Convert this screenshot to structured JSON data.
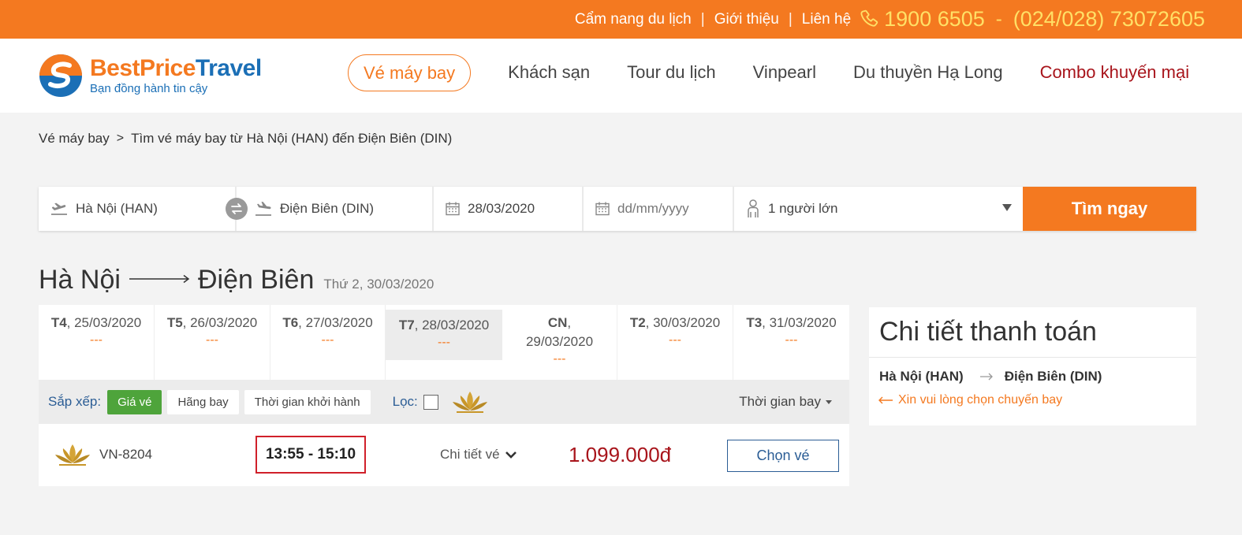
{
  "topbar": {
    "links": [
      "Cẩm nang du lịch",
      "Giới thiệu",
      "Liên hệ"
    ],
    "separator": "|",
    "phone_main": "1900 6505",
    "phone_dash": "-",
    "phone_alt": "(024/028) 73072605",
    "bg_color": "#f47920",
    "phone_color": "#ffe066"
  },
  "logo": {
    "name_part1": "BestPrice",
    "name_part2": "Travel",
    "tagline": "Bạn đồng hành tin cậy"
  },
  "nav": {
    "items": [
      "Vé máy bay",
      "Khách sạn",
      "Tour du lịch",
      "Vinpearl",
      "Du thuyền Hạ Long",
      "Combo khuyến mại"
    ],
    "active": "Vé máy bay"
  },
  "breadcrumb": {
    "home": "Vé máy bay",
    "separator": ">",
    "current": "Tìm vé máy bay từ Hà Nội (HAN) đến Điện Biên (DIN)"
  },
  "search": {
    "from": "Hà Nội (HAN)",
    "to": "Điện Biên (DIN)",
    "depart_date": "28/03/2020",
    "return_placeholder": "dd/mm/yyyy",
    "passengers": "1 người lớn",
    "button": "Tìm ngay"
  },
  "route": {
    "from": "Hà Nội",
    "to": "Điện Biên",
    "date": "Thứ 2, 30/03/2020"
  },
  "date_strip": [
    {
      "day": "T4",
      "date": ", 25/03/2020",
      "price": "---"
    },
    {
      "day": "T5",
      "date": ", 26/03/2020",
      "price": "---"
    },
    {
      "day": "T6",
      "date": ", 27/03/2020",
      "price": "---"
    },
    {
      "day": "T7",
      "date": ", 28/03/2020",
      "price": "---"
    },
    {
      "day": "CN",
      "date": ",",
      "date2": "29/03/2020",
      "price": "---"
    },
    {
      "day": "T2",
      "date": ", 30/03/2020",
      "price": "---"
    },
    {
      "day": "T3",
      "date": ", 31/03/2020",
      "price": "---"
    }
  ],
  "sortbar": {
    "sort_label": "Sắp xếp:",
    "chips": [
      "Giá vé",
      "Hãng bay",
      "Thời gian khởi hành"
    ],
    "filter_label": "Lọc:",
    "duration": "Thời gian bay"
  },
  "flight": {
    "code": "VN-8204",
    "time": "13:55 - 15:10",
    "detail": "Chi tiết vé",
    "price": "1.099.000đ",
    "choose": "Chọn vé"
  },
  "payment": {
    "title": "Chi tiết thanh toán",
    "from": "Hà Nội (HAN)",
    "to": "Điện Biên (DIN)",
    "hint": "Xin vui lòng chọn chuyến bay"
  }
}
